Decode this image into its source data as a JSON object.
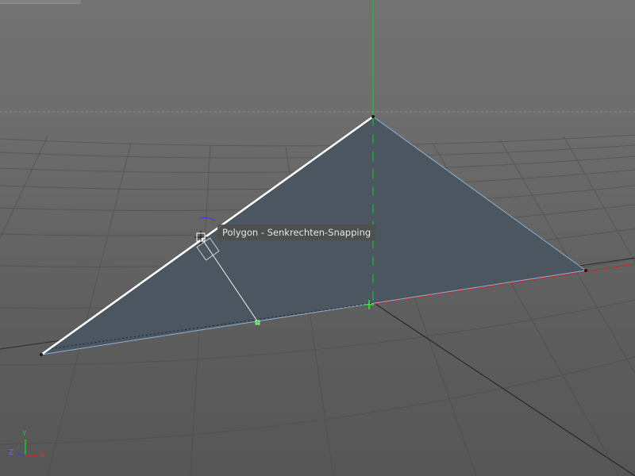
{
  "viewport": {
    "tooltip_text": "Polygon - Senkrechten-Snapping",
    "axis_labels": {
      "y": "Y",
      "z": "Z",
      "x": "X"
    },
    "colors": {
      "polygon_fill": "#4c5661",
      "polygon_edge": "#8fb1d8",
      "selected_edge": "#ffffff",
      "y_axis": "#23c23a",
      "x_axis": "#c02a2a",
      "z_axis": "#3b3bd6",
      "snap_point": "#39e639"
    },
    "icons": [
      "snap-cursor-icon",
      "perpendicular-marker-icon",
      "axis-gizmo-icon"
    ]
  }
}
